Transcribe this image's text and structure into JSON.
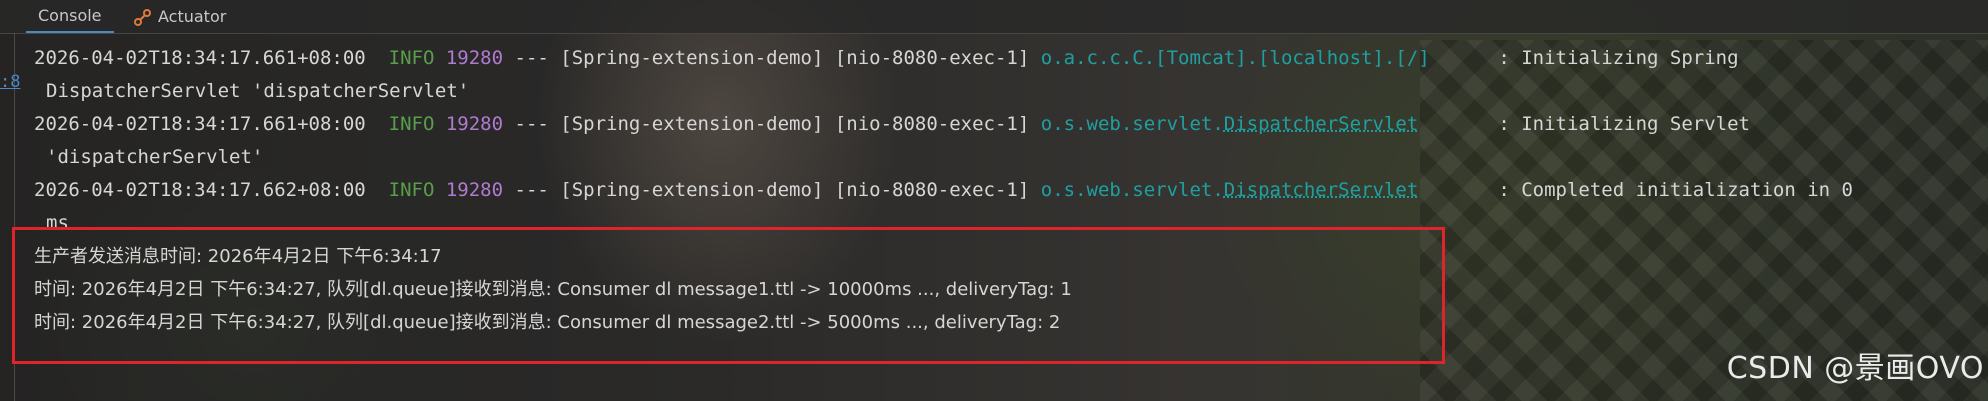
{
  "tabs": [
    {
      "label": "Console",
      "active": true
    },
    {
      "label": "Actuator",
      "icon": "actuator-icon",
      "active": false
    }
  ],
  "gutter": {
    "link_text": ":8"
  },
  "log_lines": [
    {
      "type": "log",
      "timestamp": "2026-04-02T18:34:17.661+08:00",
      "level": "INFO",
      "pid": "19280",
      "sep": "---",
      "app": "[Spring-extension-demo]",
      "thread": "[nio-8080-exec-1]",
      "logger_prefix": "o.a.c.c.C.[Tomcat].[localhost].[/]",
      "logger_link": "",
      "message": ": Initializing Spring"
    },
    {
      "type": "cont",
      "text": "DispatcherServlet 'dispatcherServlet'"
    },
    {
      "type": "log",
      "timestamp": "2026-04-02T18:34:17.661+08:00",
      "level": "INFO",
      "pid": "19280",
      "sep": "---",
      "app": "[Spring-extension-demo]",
      "thread": "[nio-8080-exec-1]",
      "logger_prefix": "o.s.web.servlet.",
      "logger_link": "DispatcherServlet",
      "message": ": Initializing Servlet"
    },
    {
      "type": "cont",
      "text": "'dispatcherServlet'"
    },
    {
      "type": "log",
      "timestamp": "2026-04-02T18:34:17.662+08:00",
      "level": "INFO",
      "pid": "19280",
      "sep": "---",
      "app": "[Spring-extension-demo]",
      "thread": "[nio-8080-exec-1]",
      "logger_prefix": "o.s.web.servlet.",
      "logger_link": "DispatcherServlet",
      "message": ": Completed initialization in 0"
    },
    {
      "type": "cont",
      "text": "ms"
    },
    {
      "type": "plain",
      "text": "生产者发送消息时间: 2026年4月2日 下午6:34:17"
    },
    {
      "type": "plain",
      "text": "时间: 2026年4月2日 下午6:34:27, 队列[dl.queue]接收到消息: Consumer dl message1.ttl -> 10000ms ..., deliveryTag: 1"
    },
    {
      "type": "plain",
      "text": "时间: 2026年4月2日 下午6:34:27, 队列[dl.queue]接收到消息: Consumer dl message2.ttl -> 5000ms ..., deliveryTag: 2"
    }
  ],
  "watermark": "CSDN @景画OVO",
  "colors": {
    "info": "#5a9e4b",
    "pid": "#b07ad0",
    "logger": "#1fa0a0",
    "highlight_border": "#e0242b",
    "tab_active": "#4a88c7"
  }
}
